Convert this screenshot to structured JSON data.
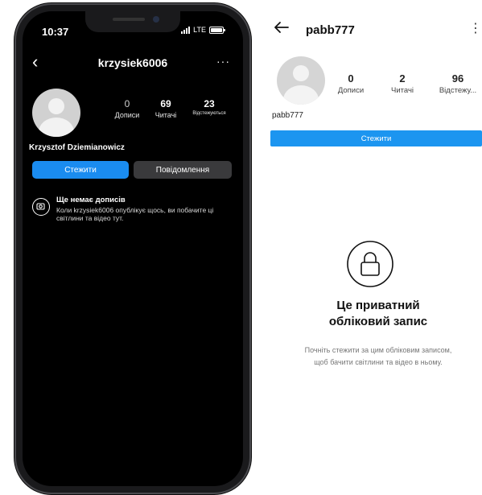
{
  "dark_screen": {
    "status": {
      "time": "10:37",
      "network": "LTE"
    },
    "header": {
      "username": "krzysiek6006",
      "more": "···"
    },
    "stats": [
      {
        "value": "0",
        "label": "Дописи"
      },
      {
        "value": "69",
        "label": "Читачі"
      },
      {
        "value": "23",
        "label": "Відстежуються"
      }
    ],
    "full_name": "Krzysztof Dziemianowicz",
    "buttons": {
      "follow": "Стежити",
      "message": "Повідомлення"
    },
    "empty_state": {
      "title": "Ще немає дописів",
      "text": "Коли krzysiek6006 опублікує щось, ви побачите ці світлини та відео тут."
    }
  },
  "light_screen": {
    "header": {
      "username": "pabb777",
      "more": "⋮"
    },
    "stats": [
      {
        "value": "0",
        "label": "Дописи"
      },
      {
        "value": "2",
        "label": "Читачі"
      },
      {
        "value": "96",
        "label": "Відстежу..."
      }
    ],
    "name": "pabb777",
    "follow_button": "Стежити",
    "private": {
      "title_line1": "Це приватний",
      "title_line2": "обліковий запис",
      "text": "Почніть стежити за цим обліковим записом, щоб бачити світлини та відео в ньому."
    }
  },
  "colors": {
    "follow_blue_dark": "#1a8cf0",
    "follow_blue_light": "#1c95f0",
    "message_gray": "#3a3a3c"
  }
}
